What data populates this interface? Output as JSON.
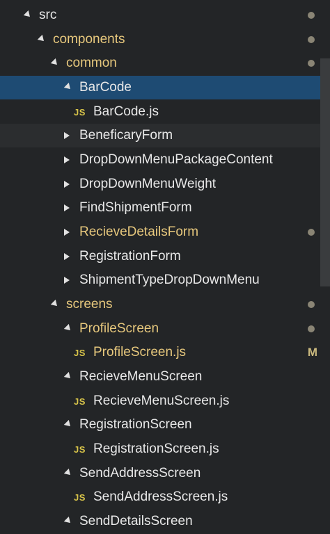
{
  "explorer": {
    "items": [
      {
        "label": "src",
        "type": "folder",
        "open": true,
        "status_dot": true
      },
      {
        "label": "components",
        "type": "folder",
        "open": true,
        "status_dot": true
      },
      {
        "label": "common",
        "type": "folder",
        "open": true,
        "status_dot": true
      },
      {
        "label": "BarCode",
        "type": "folder",
        "open": true,
        "selected": true
      },
      {
        "label": "BarCode.js",
        "type": "file",
        "icon": "JS"
      },
      {
        "label": "BeneficaryForm",
        "type": "folder",
        "open": false,
        "hover": true
      },
      {
        "label": "DropDownMenuPackageContent",
        "type": "folder",
        "open": false
      },
      {
        "label": "DropDownMenuWeight",
        "type": "folder",
        "open": false
      },
      {
        "label": "FindShipmentForm",
        "type": "folder",
        "open": false
      },
      {
        "label": "RecieveDetailsForm",
        "type": "folder",
        "open": false,
        "modified": true,
        "status_dot": true
      },
      {
        "label": "RegistrationForm",
        "type": "folder",
        "open": false
      },
      {
        "label": "ShipmentTypeDropDownMenu",
        "type": "folder",
        "open": false
      },
      {
        "label": "screens",
        "type": "folder",
        "open": true,
        "status_dot": true
      },
      {
        "label": "ProfileScreen",
        "type": "folder",
        "open": true,
        "modified": true,
        "status_dot": true
      },
      {
        "label": "ProfileScreen.js",
        "type": "file",
        "icon": "JS",
        "modified": true,
        "badge": "M"
      },
      {
        "label": "RecieveMenuScreen",
        "type": "folder",
        "open": true
      },
      {
        "label": "RecieveMenuScreen.js",
        "type": "file",
        "icon": "JS"
      },
      {
        "label": "RegistrationScreen",
        "type": "folder",
        "open": true
      },
      {
        "label": "RegistrationScreen.js",
        "type": "file",
        "icon": "JS"
      },
      {
        "label": "SendAddressScreen",
        "type": "folder",
        "open": true
      },
      {
        "label": "SendAddressScreen.js",
        "type": "file",
        "icon": "JS"
      },
      {
        "label": "SendDetailsScreen",
        "type": "folder",
        "open": true
      }
    ]
  },
  "colors": {
    "background": "#232527",
    "selected": "#1e4b73",
    "modified_text": "#e7c87d",
    "js_icon": "#d8c44a",
    "status_dot": "#8a8575"
  }
}
